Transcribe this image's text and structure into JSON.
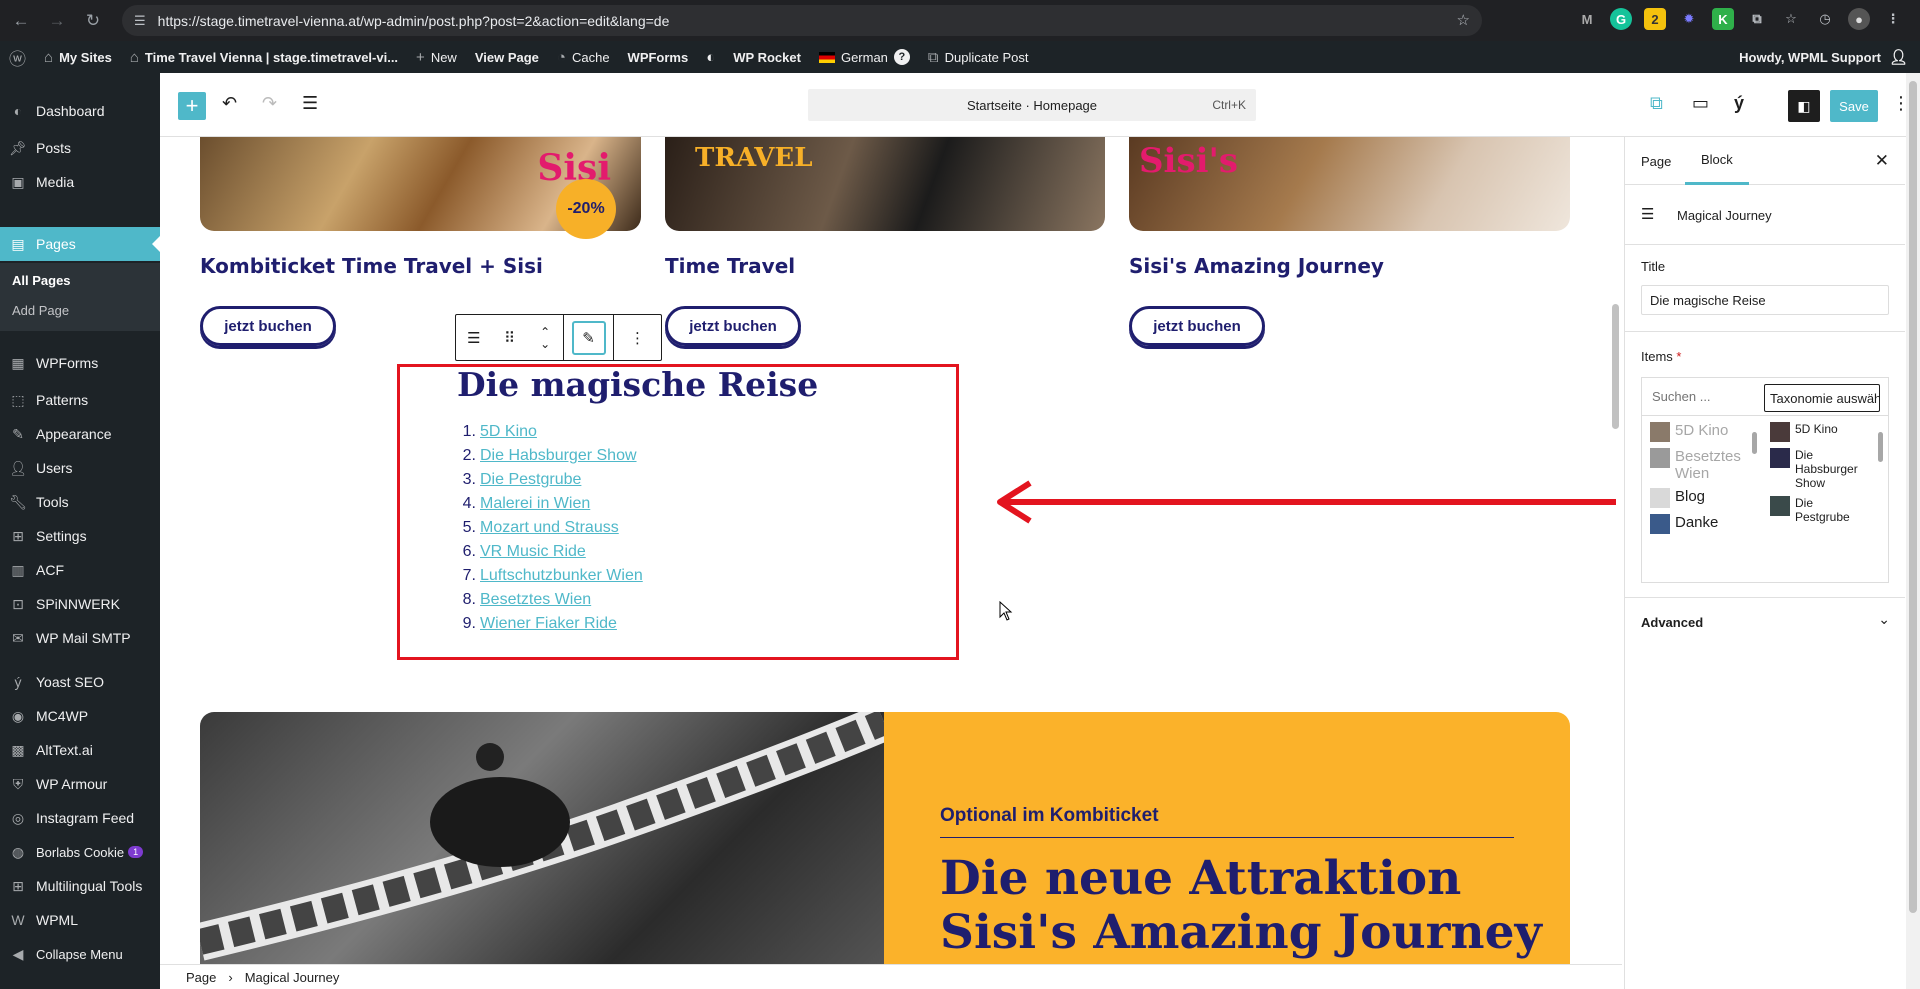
{
  "browser": {
    "url": "https://stage.timetravel-vienna.at/wp-admin/post.php?post=2&action=edit&lang=de"
  },
  "adminbar": {
    "my_sites": "My Sites",
    "site_name": "Time Travel Vienna | stage.timetravel-vi...",
    "new": "New",
    "view_page": "View Page",
    "cache": "Cache",
    "wpforms": "WPForms",
    "wp_rocket": "WP Rocket",
    "language": "German",
    "duplicate": "Duplicate Post",
    "howdy": "Howdy, WPML Support"
  },
  "sidebar": {
    "items": [
      {
        "label": "Dashboard",
        "icon": "dashboard-icon"
      },
      {
        "label": "Posts",
        "icon": "pin-icon"
      },
      {
        "label": "Media",
        "icon": "media-icon"
      },
      {
        "label": "Pages",
        "icon": "pages-icon"
      },
      {
        "label": "WPForms",
        "icon": "forms-icon"
      },
      {
        "label": "Patterns",
        "icon": "patterns-icon"
      },
      {
        "label": "Appearance",
        "icon": "brush-icon"
      },
      {
        "label": "Users",
        "icon": "user-icon"
      },
      {
        "label": "Tools",
        "icon": "wrench-icon"
      },
      {
        "label": "Settings",
        "icon": "settings-icon"
      },
      {
        "label": "ACF",
        "icon": "acf-icon"
      },
      {
        "label": "SPiNNWERK",
        "icon": "spinnwerk-icon"
      },
      {
        "label": "WP Mail SMTP",
        "icon": "mail-icon"
      },
      {
        "label": "Yoast SEO",
        "icon": "yoast-icon"
      },
      {
        "label": "MC4WP",
        "icon": "mc4wp-icon"
      },
      {
        "label": "AltText.ai",
        "icon": "alttext-icon"
      },
      {
        "label": "WP Armour",
        "icon": "shield-icon"
      },
      {
        "label": "Instagram Feed",
        "icon": "instagram-icon"
      },
      {
        "label": "Borlabs Cookie",
        "icon": "cookie-icon",
        "badge": "1"
      },
      {
        "label": "Multilingual Tools",
        "icon": "tools-icon"
      },
      {
        "label": "WPML",
        "icon": "wpml-icon"
      },
      {
        "label": "Collapse Menu",
        "icon": "collapse-icon"
      }
    ],
    "submenu": [
      "All Pages",
      "Add Page"
    ]
  },
  "editor": {
    "command_bar": "Startseite · Homepage",
    "shortcut": "Ctrl+K",
    "save": "Save"
  },
  "canvas": {
    "cards": [
      {
        "title": "Kombiticket Time Travel + Sisi",
        "button": "jetzt buchen"
      },
      {
        "title": "Time Travel",
        "button": "jetzt buchen"
      },
      {
        "title": "Sisi's Amazing Journey",
        "button": "jetzt buchen"
      }
    ],
    "discount": "-20%",
    "block_title": "Die magische Reise",
    "list": [
      "5D Kino",
      "Die Habsburger Show",
      "Die Pestgrube",
      "Malerei in Wien",
      "Mozart und Strauss",
      "VR Music Ride",
      "Luftschutzbunker Wien",
      "Besetztes Wien",
      "Wiener Fiaker Ride"
    ],
    "banner_label": "Optional im Kombiticket",
    "banner_title_1": "Die neue Attraktion",
    "banner_title_2": "Sisi's Amazing Journey"
  },
  "breadcrumb": {
    "root": "Page",
    "current": "Magical Journey"
  },
  "settings": {
    "tab_page": "Page",
    "tab_block": "Block",
    "block_name": "Magical Journey",
    "title_label": "Title",
    "title_value": "Die magische Reise",
    "items_label": "Items",
    "required": "*",
    "search_placeholder": "Suchen ...",
    "taxonomy_select": "Taxonomie auswählen",
    "available": [
      "5D Kino",
      "Besetztes Wien",
      "Blog",
      "Danke"
    ],
    "selected": [
      "5D Kino",
      "Die Habsburger Show",
      "Die Pestgrube"
    ],
    "advanced": "Advanced"
  },
  "colors": {
    "accent": "#4fb8c9",
    "navy": "#1f1e6e",
    "highlight": "#e3141f",
    "orange": "#fbb22a"
  }
}
